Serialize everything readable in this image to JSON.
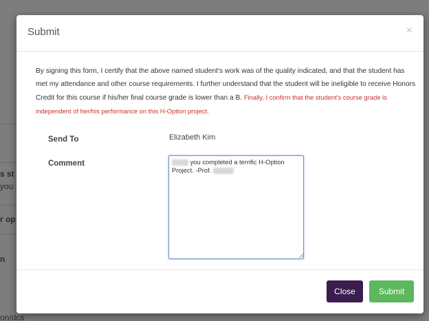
{
  "modal": {
    "title": "Submit",
    "close_icon": "×",
    "certification_text": "By signing this form, I certify that the above named student's work was of the quality indicated, and that the student has met my attendance and other course requirements. I further understand that the student will be ineligible to receive Honors Credit for this course if his/her final course grade is lower than a B.",
    "certification_emphasis": "Finally, I confirm that the student's course grade is independent of her/his performance on this H-Option project.",
    "send_to_label": "Send To",
    "send_to_value": "Elizabeth Kim",
    "comment_label": "Comment",
    "comment_text": "you completed a terrific H-Option Project.  -Prof.",
    "close_button": "Close",
    "submit_button": "Submit"
  },
  "colors": {
    "close_button": "#3b1c4f",
    "submit_button": "#5cb85c",
    "emphasis_text": "#c9302c",
    "textarea_focus": "#6f8fbf"
  }
}
